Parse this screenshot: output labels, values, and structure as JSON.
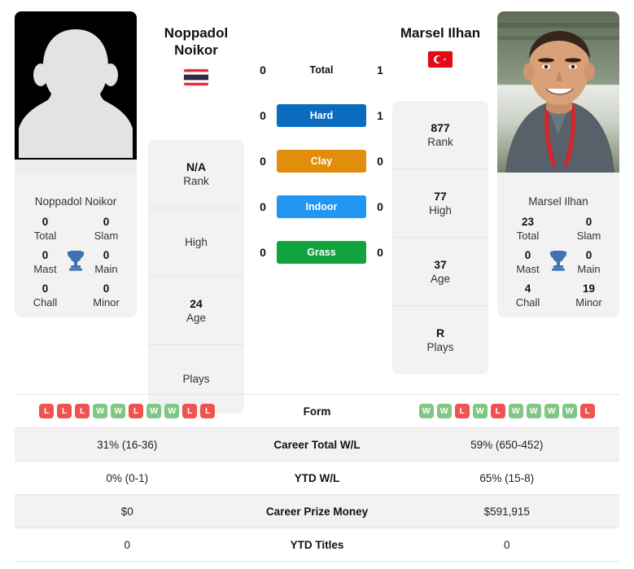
{
  "players": {
    "left": {
      "name": "Noppadol Noikor",
      "name_line1": "Noppadol",
      "name_line2": "Noikor",
      "country": "Thailand",
      "flag_icon": "thailand-flag-icon",
      "photo_type": "placeholder-avatar",
      "info": [
        {
          "value": "N/A",
          "label": "Rank"
        },
        {
          "value": "",
          "label": "High"
        },
        {
          "value": "24",
          "label": "Age"
        },
        {
          "value": "",
          "label": "Plays"
        }
      ],
      "titles": [
        {
          "value": "0",
          "label": "Total"
        },
        {
          "value": "0",
          "label": "Slam"
        },
        {
          "value": "0",
          "label": "Mast"
        },
        {
          "value": "0",
          "label": "Main"
        },
        {
          "value": "0",
          "label": "Chall"
        },
        {
          "value": "0",
          "label": "Minor"
        }
      ],
      "form": [
        "L",
        "L",
        "L",
        "W",
        "W",
        "L",
        "W",
        "W",
        "L",
        "L"
      ],
      "career_total_wl": "31% (16-36)",
      "ytd_wl": "0% (0-1)",
      "career_prize_money": "$0",
      "ytd_titles": "0"
    },
    "right": {
      "name": "Marsel Ilhan",
      "name_line1": "Marsel Ilhan",
      "name_line2": "",
      "country": "Turkey",
      "flag_icon": "turkey-flag-icon",
      "photo_type": "player-photo",
      "info": [
        {
          "value": "877",
          "label": "Rank"
        },
        {
          "value": "77",
          "label": "High"
        },
        {
          "value": "37",
          "label": "Age"
        },
        {
          "value": "R",
          "label": "Plays"
        }
      ],
      "titles": [
        {
          "value": "23",
          "label": "Total"
        },
        {
          "value": "0",
          "label": "Slam"
        },
        {
          "value": "0",
          "label": "Mast"
        },
        {
          "value": "0",
          "label": "Main"
        },
        {
          "value": "4",
          "label": "Chall"
        },
        {
          "value": "19",
          "label": "Minor"
        }
      ],
      "form": [
        "W",
        "W",
        "L",
        "W",
        "L",
        "W",
        "W",
        "W",
        "W",
        "L"
      ],
      "career_total_wl": "59% (650-452)",
      "ytd_wl": "65% (15-8)",
      "career_prize_money": "$591,915",
      "ytd_titles": "0"
    }
  },
  "head_to_head": [
    {
      "label": "Total",
      "left": "0",
      "right": "1",
      "style": "plain",
      "color": ""
    },
    {
      "label": "Hard",
      "left": "0",
      "right": "1",
      "style": "chip",
      "color": "#0b6cbf"
    },
    {
      "label": "Clay",
      "left": "0",
      "right": "0",
      "style": "chip",
      "color": "#e08e0b"
    },
    {
      "label": "Indoor",
      "left": "0",
      "right": "0",
      "style": "chip",
      "color": "#2196f3"
    },
    {
      "label": "Grass",
      "left": "0",
      "right": "0",
      "style": "chip",
      "color": "#11a33e"
    }
  ],
  "table": {
    "rows": [
      {
        "label": "Form",
        "left": "",
        "right": "",
        "type": "form",
        "shade": false
      },
      {
        "label": "Career Total W/L",
        "left": "31% (16-36)",
        "right": "59% (650-452)",
        "type": "text",
        "shade": true
      },
      {
        "label": "YTD W/L",
        "left": "0% (0-1)",
        "right": "65% (15-8)",
        "type": "text",
        "shade": false
      },
      {
        "label": "Career Prize Money",
        "left": "$0",
        "right": "$591,915",
        "type": "text",
        "shade": true
      },
      {
        "label": "YTD Titles",
        "left": "0",
        "right": "0",
        "type": "text",
        "shade": false
      }
    ]
  },
  "colors": {
    "hard": "#0b6cbf",
    "clay": "#e08e0b",
    "indoor": "#2196f3",
    "grass": "#11a33e",
    "win_badge": "#81c784",
    "loss_badge": "#ef5350",
    "card_bg": "#f2f2f2",
    "trophy": "#3f72b4"
  },
  "icons": {
    "trophy": "trophy-icon",
    "avatar_placeholder": "avatar-placeholder-icon"
  }
}
